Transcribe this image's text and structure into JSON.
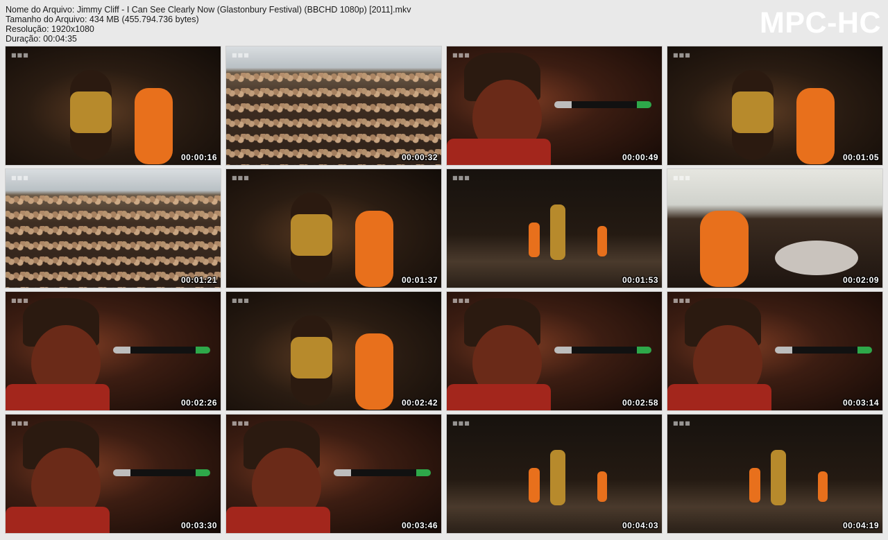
{
  "info": {
    "filename_line": "Nome do Arquivo: Jimmy Cliff - I Can See Clearly Now (Glastonbury Festival) (BBCHD 1080p) [2011].mkv",
    "size_line": "Tamanho do Arquivo: 434 MB (455.794.736 bytes)",
    "resolution_line": "Resolução: 1920x1080",
    "duration_line": "Duração: 00:04:35"
  },
  "logo": "MPC-HC",
  "colors": {
    "background": "#e9e9e9",
    "timestamp": "#ffffff",
    "logo": "#ffffff"
  },
  "thumbnails": [
    {
      "time": "00:00:16",
      "scene": "stage"
    },
    {
      "time": "00:00:32",
      "scene": "crowd"
    },
    {
      "time": "00:00:49",
      "scene": "closeup"
    },
    {
      "time": "00:01:05",
      "scene": "band"
    },
    {
      "time": "00:01:21",
      "scene": "crowd"
    },
    {
      "time": "00:01:37",
      "scene": "band"
    },
    {
      "time": "00:01:53",
      "scene": "wide"
    },
    {
      "time": "00:02:09",
      "scene": "drummer"
    },
    {
      "time": "00:02:26",
      "scene": "closeup"
    },
    {
      "time": "00:02:42",
      "scene": "guitar"
    },
    {
      "time": "00:02:58",
      "scene": "closeup"
    },
    {
      "time": "00:03:14",
      "scene": "closeup"
    },
    {
      "time": "00:03:30",
      "scene": "closeup"
    },
    {
      "time": "00:03:46",
      "scene": "closeup"
    },
    {
      "time": "00:04:03",
      "scene": "wide"
    },
    {
      "time": "00:04:19",
      "scene": "wide"
    }
  ]
}
